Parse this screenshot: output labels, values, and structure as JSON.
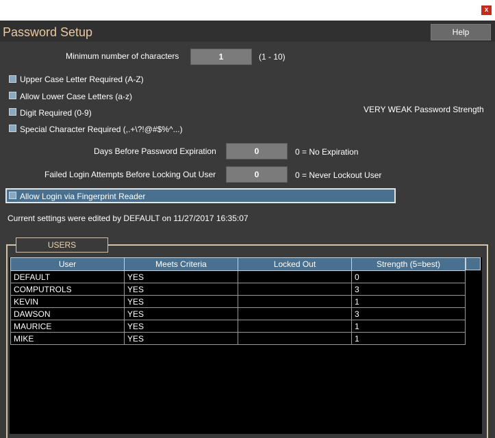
{
  "window": {
    "close_glyph": "x"
  },
  "header": {
    "title": "Password Setup",
    "help_label": "Help"
  },
  "min_chars": {
    "label": "Minimum number of characters",
    "value": "1",
    "range": "(1 - 10)"
  },
  "options": [
    {
      "label": "Upper Case Letter Required (A-Z)",
      "checked": false
    },
    {
      "label": "Allow Lower Case Letters (a-z)",
      "checked": false
    },
    {
      "label": "Digit Required (0-9)",
      "checked": false
    },
    {
      "label": "Special Character Required (,.+\\?!@#$%^...)",
      "checked": false
    }
  ],
  "strength_text": "VERY WEAK Password Strength",
  "expiration": {
    "label": "Days Before Password Expiration",
    "value": "0",
    "hint": "0 = No Expiration"
  },
  "lockout": {
    "label": "Failed Login Attempts Before Locking Out User",
    "value": "0",
    "hint": "0 = Never Lockout User"
  },
  "fingerprint": {
    "label": "Allow Login via Fingerprint Reader",
    "checked": false
  },
  "edited_text": "Current settings were edited by DEFAULT on 11/27/2017  16:35:07",
  "users": {
    "group_title": "USERS",
    "columns": [
      "User",
      "Meets Criteria",
      "Locked Out",
      "Strength (5=best)"
    ],
    "rows": [
      [
        "DEFAULT",
        "YES",
        "",
        "0"
      ],
      [
        "COMPUTROLS",
        "YES",
        "",
        "3"
      ],
      [
        "KEVIN",
        "YES",
        "",
        "1"
      ],
      [
        "DAWSON",
        "YES",
        "",
        "3"
      ],
      [
        "MAURICE",
        "YES",
        "",
        "1"
      ],
      [
        "MIKE",
        "YES",
        "",
        "1"
      ]
    ]
  }
}
